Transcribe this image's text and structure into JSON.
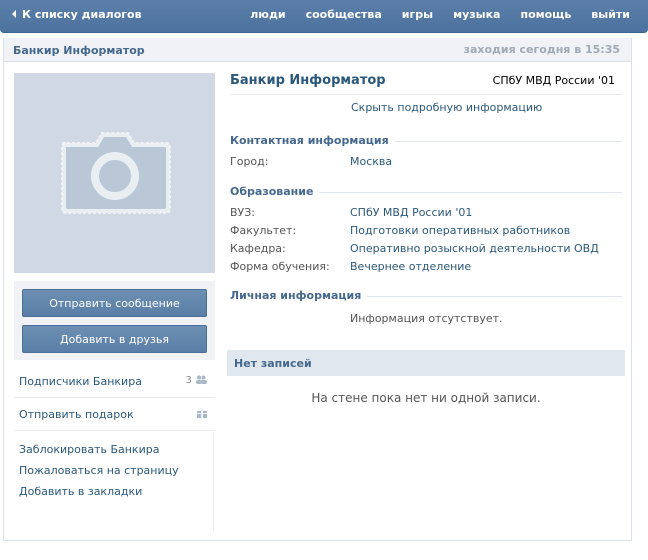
{
  "topbar": {
    "back_label": "К списку диалогов",
    "nav": [
      "люди",
      "сообщества",
      "игры",
      "музыка",
      "помощь",
      "выйти"
    ]
  },
  "header": {
    "name": "Банкир Информатор",
    "status": "заходия сегодня в 15:35"
  },
  "actions": {
    "send_message": "Отправить сообщение",
    "add_friend": "Добавить в друзья"
  },
  "sidebar": {
    "subscribers_label": "Подписчики Банкира",
    "subscribers_count": "3",
    "gift_label": "Отправить подарок",
    "links": [
      "Заблокировать Банкира",
      "Пожаловаться на страницу",
      "Добавить в закладки"
    ]
  },
  "profile": {
    "name": "Банкир Информатор",
    "short_status": "СПбУ МВД России '01",
    "hide_details": "Скрыть подробную информацию",
    "contact": {
      "title": "Контактная информация",
      "city_label": "Город:",
      "city_value": "Москва"
    },
    "education": {
      "title": "Образование",
      "rows": [
        {
          "label": "ВУЗ:",
          "value": "СПбУ МВД России '01"
        },
        {
          "label": "Факультет:",
          "value": "Подготовки оперативных работников"
        },
        {
          "label": "Кафедра:",
          "value": "Оперативно розыскной деятельности ОВД"
        },
        {
          "label": "Форма обучения:",
          "value": "Вечернее отделение"
        }
      ]
    },
    "personal": {
      "title": "Личная информация",
      "empty": "Информация отсутствует."
    }
  },
  "wall": {
    "title": "Нет записей",
    "empty": "На стене пока нет ни одной записи."
  },
  "colors": {
    "topbar": "#4d72a0",
    "link": "#2b587a",
    "section_title": "#45688e",
    "button": "#5a7ea6"
  },
  "icons": [
    "back-arrow-icon",
    "camera-placeholder-icon",
    "people-icon",
    "gift-icon"
  ]
}
